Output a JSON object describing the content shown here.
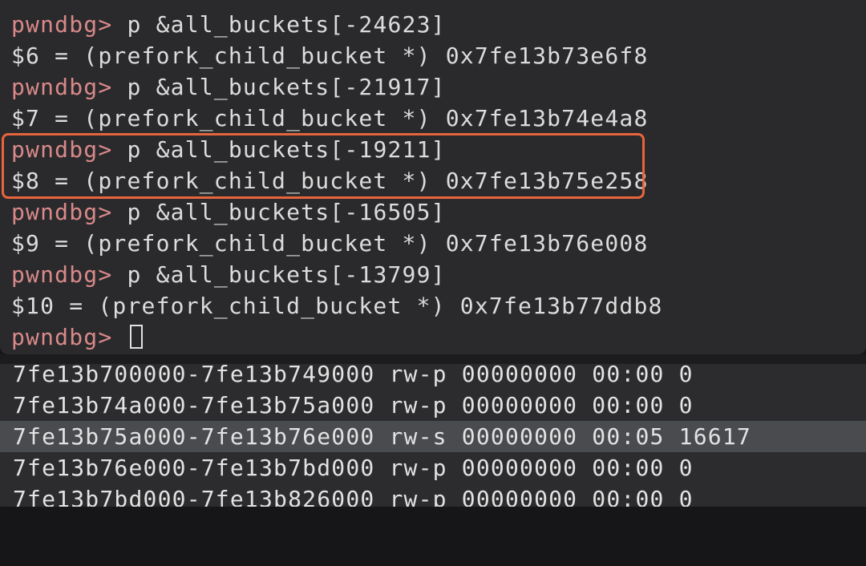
{
  "terminal": {
    "prompt": "pwndbg>",
    "history": [
      {
        "command": "p &all_buckets[-24623]",
        "output": "$6 = (prefork_child_bucket *) 0x7fe13b73e6f8"
      },
      {
        "command": "p &all_buckets[-21917]",
        "output": "$7 = (prefork_child_bucket *) 0x7fe13b74e4a8"
      },
      {
        "command": "p &all_buckets[-19211]",
        "output": "$8 = (prefork_child_bucket *) 0x7fe13b75e258"
      },
      {
        "command": "p &all_buckets[-16505]",
        "output": "$9 = (prefork_child_bucket *) 0x7fe13b76e008"
      },
      {
        "command": "p &all_buckets[-13799]",
        "output": "$10 = (prefork_child_bucket *) 0x7fe13b77ddb8"
      }
    ]
  },
  "memory_maps": {
    "rows": [
      "7fe13b700000-7fe13b749000 rw-p 00000000 00:00 0",
      "7fe13b74a000-7fe13b75a000 rw-p 00000000 00:00 0",
      "7fe13b75a000-7fe13b76e000 rw-s 00000000 00:05 16617",
      "7fe13b76e000-7fe13b7bd000 rw-p 00000000 00:00 0",
      "7fe13b7bd000-7fe13b826000 rw-p 00000000 00:00 0"
    ]
  },
  "colors": {
    "prompt": "#d9898a",
    "highlight_border": "#e8643c",
    "selected_row": "#4a4b4f"
  }
}
